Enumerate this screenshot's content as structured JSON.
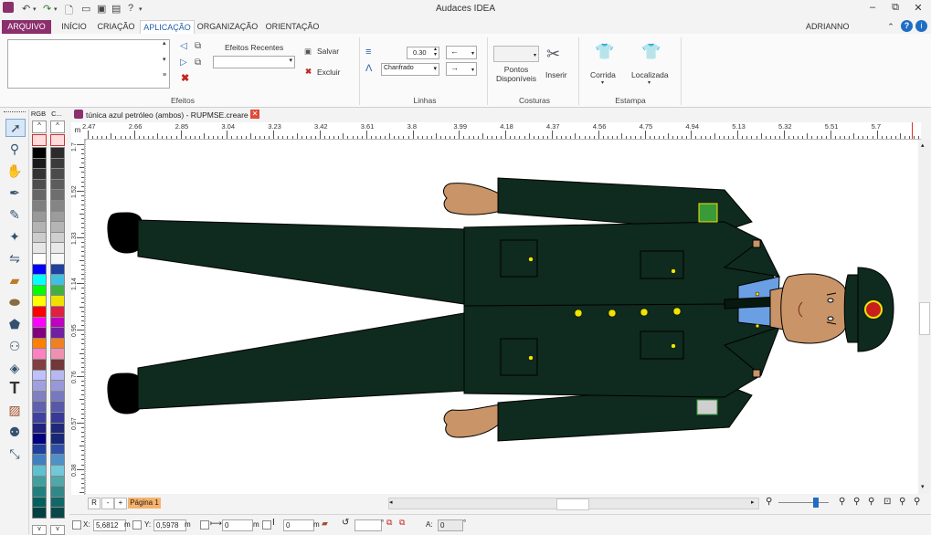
{
  "window": {
    "title": "Audaces IDEA",
    "controls": {
      "minimize": "–",
      "restore": "⧉",
      "close": "✕"
    }
  },
  "tabs": [
    {
      "label": "ARQUIVO"
    },
    {
      "label": "INÍCIO"
    },
    {
      "label": "CRIAÇÃO"
    },
    {
      "label": "APLICAÇÃO"
    },
    {
      "label": "ORGANIZAÇÃO"
    },
    {
      "label": "ORIENTAÇÃO"
    }
  ],
  "active_tab": "APLICAÇÃO",
  "user": {
    "name": "ADRIANNO FREITAS"
  },
  "ribbon": {
    "efeitos": {
      "recent_label": "Efeitos Recentes",
      "save_label": "Salvar",
      "delete_label": "Excluir",
      "group_label": "Efeitos"
    },
    "linhas": {
      "thickness_value": "0.30",
      "join_value": "Chanfrado",
      "group_label": "Linhas"
    },
    "costuras": {
      "points_label_1": "Pontos",
      "points_label_2": "Disponíveis",
      "insert_label": "Inserir",
      "group_label": "Costuras"
    },
    "estampa": {
      "run_label": "Corrida",
      "locate_label": "Localizada",
      "group_label": "Estampa"
    }
  },
  "palette": {
    "headers": [
      "RGB",
      "C..."
    ],
    "colors_rgb": [
      "#000000",
      "#1a1a1a",
      "#333333",
      "#4d4d4d",
      "#666666",
      "#808080",
      "#999999",
      "#b3b3b3",
      "#cccccc",
      "#e6e6e6",
      "#ffffff",
      "#0000ff",
      "#00ffff",
      "#00ff00",
      "#ffff00",
      "#ff0000",
      "#ff00ff",
      "#800080",
      "#ff8000",
      "#ff80c0",
      "#804040",
      "#c0c0ff",
      "#a0a0e0",
      "#8080c0",
      "#6060b0",
      "#4040a0",
      "#202080",
      "#000080",
      "#2040a0",
      "#4080c0",
      "#60c0d0",
      "#40a0a0",
      "#208080",
      "#006060",
      "#004040"
    ],
    "colors_c": [
      "#2b2b2b",
      "#3a3a3a",
      "#4b4b4b",
      "#5c5c5c",
      "#6e6e6e",
      "#858585",
      "#9c9c9c",
      "#b5b5b5",
      "#cfcfcf",
      "#e8e8e8",
      "#f8f8f8",
      "#2040a0",
      "#40c0e0",
      "#40b040",
      "#f0e000",
      "#e02040",
      "#c000c0",
      "#7020a0",
      "#f08020",
      "#f090b0",
      "#703838",
      "#b8b8f0",
      "#9898d8",
      "#7878c0",
      "#5858a8",
      "#383898",
      "#202878",
      "#182878",
      "#3050a8",
      "#5090c8",
      "#70c8d8",
      "#50a8a8",
      "#308888",
      "#106868",
      "#084848"
    ]
  },
  "document": {
    "tab_title": "túnica azul petróleo (ambos) - RUPMSE.creare *",
    "unit": "m"
  },
  "ruler": {
    "h_ticks": [
      "2.47",
      "2.66",
      "2.85",
      "3.04",
      "3.23",
      "3.42",
      "3.61",
      "3.8",
      "3.99",
      "4.18",
      "4.37",
      "4.56",
      "4.75",
      "4.94",
      "5.13",
      "5.32",
      "5.51",
      "5.7"
    ],
    "v_ticks": [
      "1.7",
      "1.52",
      "1.33",
      "1.14",
      "0.95",
      "0.76",
      "0.57",
      "0.38"
    ]
  },
  "pages": {
    "buttons": [
      "R",
      "-",
      "+"
    ],
    "current": "Página 1"
  },
  "status": {
    "x_label": "X:",
    "x_value": "5,6812",
    "x_unit": "m",
    "y_label": "Y:",
    "y_value": "0,5978",
    "y_unit": "m",
    "w_value": "0",
    "w_unit": "m",
    "h_value": "0",
    "h_unit": "m",
    "angle_label": "A:",
    "angle_value": "0",
    "angle_unit": "°"
  },
  "colors": {
    "uniform": "#0f2a1e",
    "uniform_dark": "#07190f",
    "skin": "#c99467",
    "shirt": "#6b9fe3",
    "button": "#f0e400",
    "accent_tab": "#8b2f6d",
    "page_tab": "#f6b26b"
  }
}
